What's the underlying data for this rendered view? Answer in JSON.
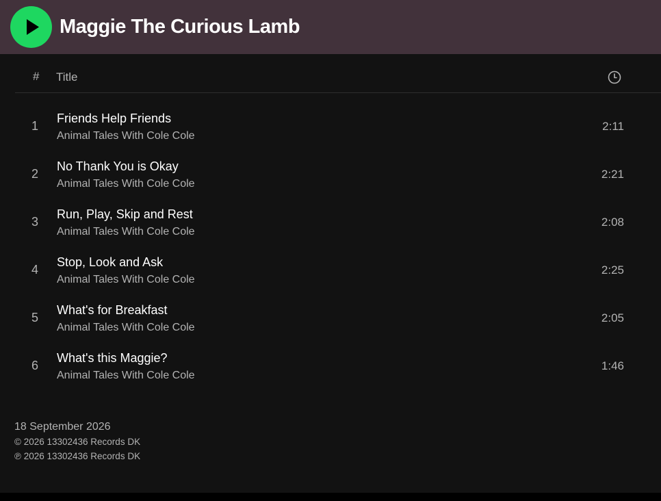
{
  "colors": {
    "header_background": "#42323b",
    "play_button": "#1ed760",
    "content_background": "#121212",
    "text_primary": "#ffffff",
    "text_secondary": "#b3b3b3"
  },
  "header": {
    "play_icon": "play-icon",
    "album_title": "Maggie The Curious Lamb"
  },
  "table_header": {
    "number_label": "#",
    "title_label": "Title",
    "duration_icon": "clock-icon"
  },
  "tracks": [
    {
      "number": "1",
      "title": "Friends Help Friends",
      "artist": "Animal Tales With Cole Cole",
      "duration": "2:11"
    },
    {
      "number": "2",
      "title": "No Thank You is Okay",
      "artist": "Animal Tales With Cole Cole",
      "duration": "2:21"
    },
    {
      "number": "3",
      "title": "Run, Play, Skip and Rest",
      "artist": "Animal Tales With Cole Cole",
      "duration": "2:08"
    },
    {
      "number": "4",
      "title": "Stop, Look and Ask",
      "artist": "Animal Tales With Cole Cole",
      "duration": "2:25"
    },
    {
      "number": "5",
      "title": "What's for Breakfast",
      "artist": "Animal Tales With Cole Cole",
      "duration": "2:05"
    },
    {
      "number": "6",
      "title": "What's this Maggie?",
      "artist": "Animal Tales With Cole Cole",
      "duration": "1:46"
    }
  ],
  "footer": {
    "release_date": "18 September 2026",
    "copyright": "© 2026 13302436 Records DK",
    "phonographic_copyright": "℗ 2026 13302436 Records DK"
  }
}
